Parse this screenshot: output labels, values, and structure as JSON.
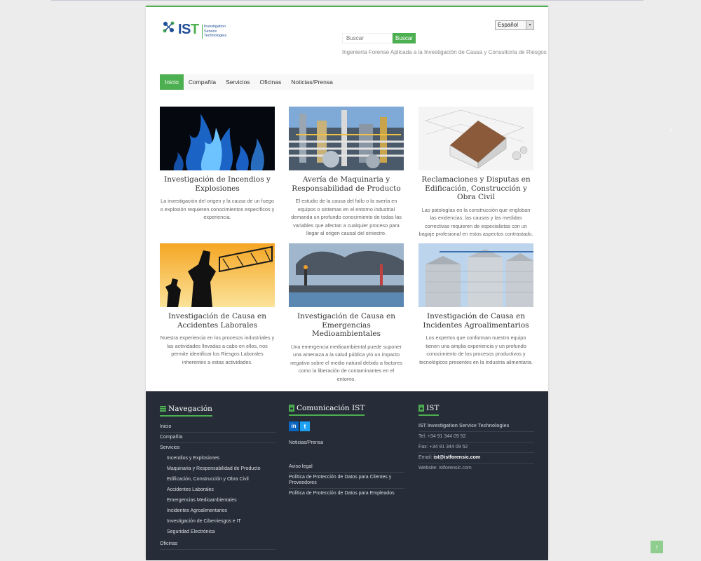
{
  "header": {
    "logo_text": "IS",
    "logo_t": "T",
    "logo_sub": [
      "Investigation",
      "Service",
      "Technologies"
    ],
    "language": "Español",
    "search_placeholder": "Buscar",
    "search_button": "Buscar",
    "tagline": "Ingeniería Forense Aplicada a la Investigación de Causa y Consultoría de Riesgos"
  },
  "nav": {
    "items": [
      "Inicio",
      "Compañía",
      "Servicios",
      "Oficinas",
      "Noticias/Prensa"
    ],
    "active": "Inicio"
  },
  "cards": [
    {
      "title": "Investigación de Incendios y Explosiones",
      "text": "La investigación del origen y la causa de un fuego o explosión requieren conocimientos específicos y experiencia."
    },
    {
      "title": "Avería de Maquinaria y Responsabilidad de Producto",
      "text": "El estudio de la causa del fallo o la avería en equipos o sistemas en el entorno industrial demanda un profundo conocimiento de todas las variables que afectan a cualquier proceso para llegar al origen causal del siniestro."
    },
    {
      "title": "Reclamaciones y Disputas en Edificación, Construcción y Obra Civil",
      "text": "Las patologías en la construcción que engloban las evidencias, las causas y las medidas correctivas requieren de especialistas con un bagaje profesional en estos aspectos contrastado."
    },
    {
      "title": "Investigación de Causa en Accidentes Laborales",
      "text": "Nuestra experiencia en los procesos industriales y las actividades llevadas a cabo en ellos, nos permite identificar los Riesgos Laborales inherentes a estas actividades."
    },
    {
      "title": "Investigación de Causa en Emergencias Medioambientales",
      "text": "Una emergencia medioambiental puede suponer una amenaza a la salud pública y/o un impacto negativo sobre el medio natural debido a factores como la liberación de contaminantes en el entorno."
    },
    {
      "title": "Investigación de Causa en Incidentes Agroalimentarios",
      "text": "Los expertos que conforman nuestro equipo tienen una amplia experiencia y un profundo conocimiento de los procesos productivos y tecnológicos presentes en la industria alimentaria."
    }
  ],
  "footer": {
    "nav_title": "Navegación",
    "nav_items": {
      "inicio": "Inicio",
      "compania": "Compañía",
      "servicios": "Servicios",
      "servicios_sub": [
        "Incendios y Explosiones",
        "Maquinaria y Responsabilidad de Producto",
        "Edificación, Construcción y Obra Civil",
        "Accidentes Laborales",
        "Emergencias Medioambientales",
        "Incidentes Agroalimentarios",
        "Investigación de Ciberriesgos e IT",
        "Seguridad Electrónica"
      ],
      "oficinas": "Oficinas"
    },
    "comm_title": "Comunicación IST",
    "social": {
      "linkedin": "in",
      "twitter": "t"
    },
    "comm_items": [
      "Noticias/Prensa",
      "Aviso legal",
      "Política de Protección de Datos para Clientes y Proveedores",
      "Política de Protección de Datos para Empleados"
    ],
    "ist_title": "IST",
    "company": "IST Investigation Service Technologies",
    "tel": "Tel: +34 91 344 09 52",
    "fax": "Fax: +34 91 344 09 52",
    "email_label": "Email: ",
    "email": "ist@istforensic.com",
    "website": "Website: istforensic.com"
  },
  "colors": {
    "accent": "#4caf50",
    "footer_bg": "#262d38",
    "brand_blue": "#1f4e96"
  },
  "to_top_icon": "arrow-up-icon"
}
